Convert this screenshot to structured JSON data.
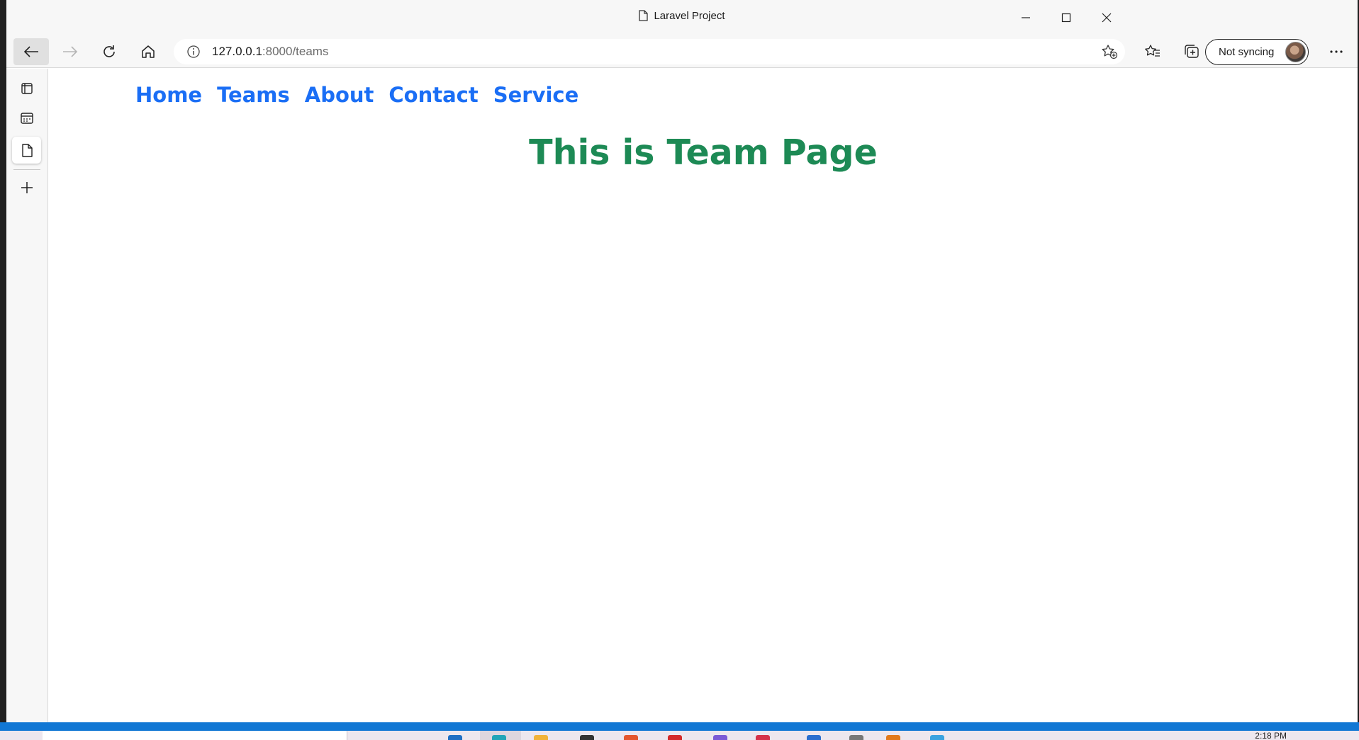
{
  "window": {
    "title": "Laravel Project"
  },
  "toolbar": {
    "url_host": "127.0.0.1",
    "url_path": ":8000/teams",
    "sync_label": "Not syncing"
  },
  "page": {
    "nav": [
      "Home",
      "Teams",
      "About",
      "Contact",
      "Service"
    ],
    "heading": "This is Team Page"
  },
  "taskbar": {
    "clock": "2:18 PM"
  },
  "colors": {
    "nav_link": "#1a6ef5",
    "heading": "#1d8a55",
    "statusbar": "#1177d4"
  },
  "icons": {
    "back": "arrow-left-icon",
    "forward": "arrow-right-icon",
    "refresh": "refresh-icon",
    "home": "home-icon",
    "info": "info-icon",
    "favorite_add": "star-plus-icon",
    "favorites": "favorites-icon",
    "collections": "collections-icon",
    "more": "more-icon"
  }
}
